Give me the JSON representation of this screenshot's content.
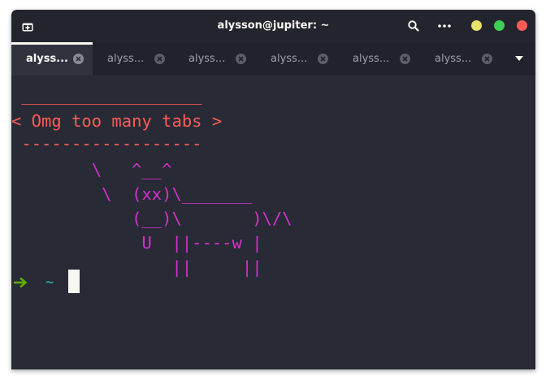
{
  "window": {
    "title": "alysson@jupiter: ~"
  },
  "header": {
    "icons": [
      "new-tab-icon",
      "search-icon",
      "kebab-menu-icon"
    ],
    "window_controls": [
      {
        "name": "minimize",
        "color": "#e7e26a"
      },
      {
        "name": "maximize",
        "color": "#3fd056"
      },
      {
        "name": "close",
        "color": "#ff5c57"
      }
    ]
  },
  "tabs": [
    {
      "label": "alyss...",
      "active": true
    },
    {
      "label": "alyss...",
      "active": false
    },
    {
      "label": "alyss...",
      "active": false
    },
    {
      "label": "alyss...",
      "active": false
    },
    {
      "label": "alyss...",
      "active": false
    },
    {
      "label": "alyss...",
      "active": false
    }
  ],
  "terminal": {
    "bubble_lines": [
      " __________________",
      "< Omg too many tabs >",
      " ------------------"
    ],
    "cow_lines": [
      "        \\   ^__^",
      "         \\  (xx)\\_______",
      "            (__)\\       )\\/\\",
      "             U  ||----w |",
      "                ||     ||"
    ],
    "prompt": {
      "arrow_icon": "right-arrow-icon",
      "directory": "~"
    }
  },
  "colors": {
    "background": "#282a36",
    "bubble_text": "#ff5c57",
    "cow_text": "#d133c9",
    "prompt_arrow": "#5faf00",
    "prompt_dir": "#2aa198",
    "cursor": "#f8f8f2"
  }
}
